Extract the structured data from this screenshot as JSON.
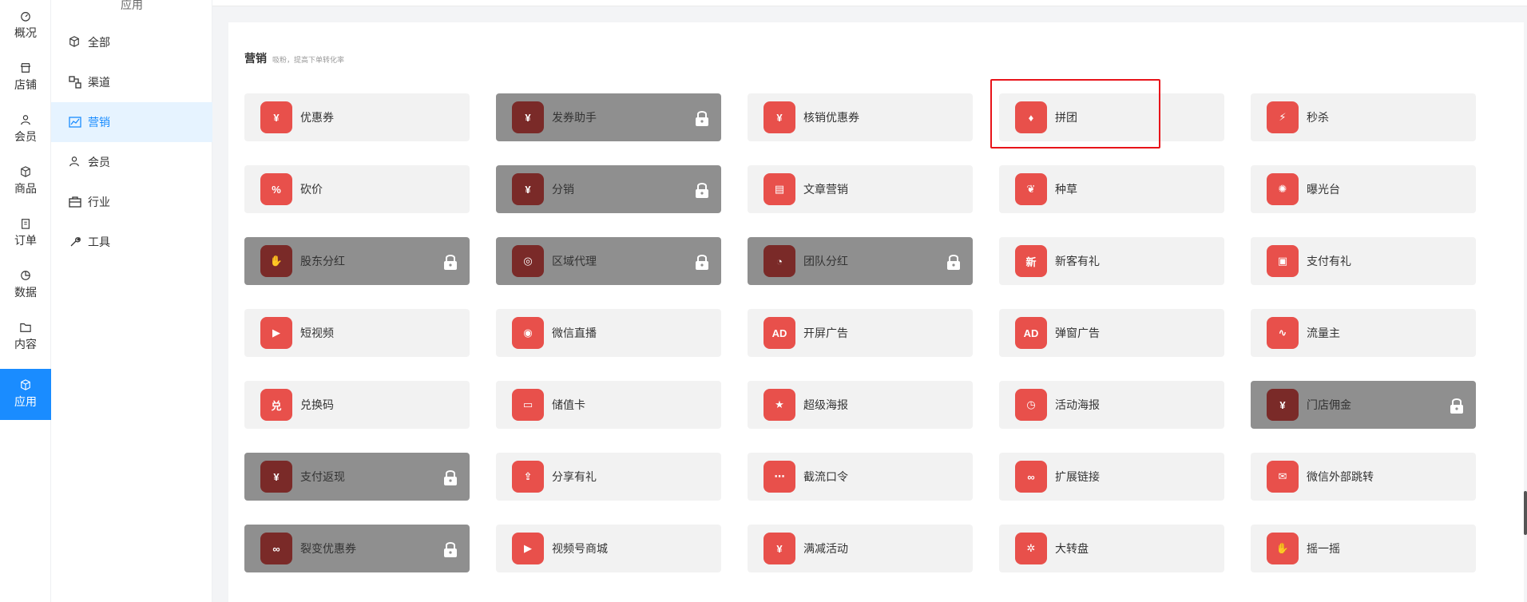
{
  "rail": {
    "items": [
      {
        "label": "概况",
        "icon": "dashboard-icon"
      },
      {
        "label": "店铺",
        "icon": "store-icon"
      },
      {
        "label": "会员",
        "icon": "user-icon"
      },
      {
        "label": "商品",
        "icon": "box-icon"
      },
      {
        "label": "订单",
        "icon": "clipboard-icon"
      },
      {
        "label": "数据",
        "icon": "pie-icon"
      },
      {
        "label": "内容",
        "icon": "folder-icon"
      },
      {
        "label": "应用",
        "icon": "cube-icon",
        "active": true
      }
    ]
  },
  "subnav": {
    "title": "应用",
    "items": [
      {
        "label": "全部",
        "icon": "cube-icon"
      },
      {
        "label": "渠道",
        "icon": "channel-icon"
      },
      {
        "label": "营销",
        "icon": "chart-icon",
        "active": true
      },
      {
        "label": "会员",
        "icon": "user-icon"
      },
      {
        "label": "行业",
        "icon": "briefcase-icon"
      },
      {
        "label": "工具",
        "icon": "wrench-icon"
      }
    ]
  },
  "section": {
    "title": "营销",
    "subtitle": "吸粉，提高下单转化率"
  },
  "tiles": [
    {
      "label": "优惠券",
      "locked": false,
      "glyph": "¥"
    },
    {
      "label": "发券助手",
      "locked": true,
      "glyph": "¥"
    },
    {
      "label": "核销优惠券",
      "locked": false,
      "glyph": "¥"
    },
    {
      "label": "拼团",
      "locked": false,
      "glyph": "♦"
    },
    {
      "label": "秒杀",
      "locked": false,
      "glyph": "⚡"
    },
    {
      "label": "砍价",
      "locked": false,
      "glyph": "%"
    },
    {
      "label": "分销",
      "locked": true,
      "glyph": "¥"
    },
    {
      "label": "文章营销",
      "locked": false,
      "glyph": "▤"
    },
    {
      "label": "种草",
      "locked": false,
      "glyph": "❦"
    },
    {
      "label": "曝光台",
      "locked": false,
      "glyph": "✺"
    },
    {
      "label": "股东分红",
      "locked": true,
      "glyph": "✋"
    },
    {
      "label": "区域代理",
      "locked": true,
      "glyph": "◎"
    },
    {
      "label": "团队分红",
      "locked": true,
      "glyph": "◔"
    },
    {
      "label": "新客有礼",
      "locked": false,
      "glyph": "新"
    },
    {
      "label": "支付有礼",
      "locked": false,
      "glyph": "▣"
    },
    {
      "label": "短视频",
      "locked": false,
      "glyph": "▶"
    },
    {
      "label": "微信直播",
      "locked": false,
      "glyph": "◉"
    },
    {
      "label": "开屏广告",
      "locked": false,
      "glyph": "AD"
    },
    {
      "label": "弹窗广告",
      "locked": false,
      "glyph": "AD"
    },
    {
      "label": "流量主",
      "locked": false,
      "glyph": "∿"
    },
    {
      "label": "兑换码",
      "locked": false,
      "glyph": "兑"
    },
    {
      "label": "储值卡",
      "locked": false,
      "glyph": "▭"
    },
    {
      "label": "超级海报",
      "locked": false,
      "glyph": "★"
    },
    {
      "label": "活动海报",
      "locked": false,
      "glyph": "◷"
    },
    {
      "label": "门店佣金",
      "locked": true,
      "glyph": "¥"
    },
    {
      "label": "支付返现",
      "locked": true,
      "glyph": "¥"
    },
    {
      "label": "分享有礼",
      "locked": false,
      "glyph": "⇪"
    },
    {
      "label": "截流口令",
      "locked": false,
      "glyph": "⋯"
    },
    {
      "label": "扩展链接",
      "locked": false,
      "glyph": "∞"
    },
    {
      "label": "微信外部跳转",
      "locked": false,
      "glyph": "✉"
    },
    {
      "label": "裂变优惠券",
      "locked": true,
      "glyph": "∞"
    },
    {
      "label": "视频号商城",
      "locked": false,
      "glyph": "▶"
    },
    {
      "label": "满减活动",
      "locked": false,
      "glyph": "¥"
    },
    {
      "label": "大转盘",
      "locked": false,
      "glyph": "✲"
    },
    {
      "label": "摇一摇",
      "locked": false,
      "glyph": "✋"
    }
  ],
  "colors": {
    "accent": "#1a8cff",
    "tile_icon": "#e8504b",
    "locked_tile": "#8f8f8f",
    "highlight": "#e8141a"
  }
}
